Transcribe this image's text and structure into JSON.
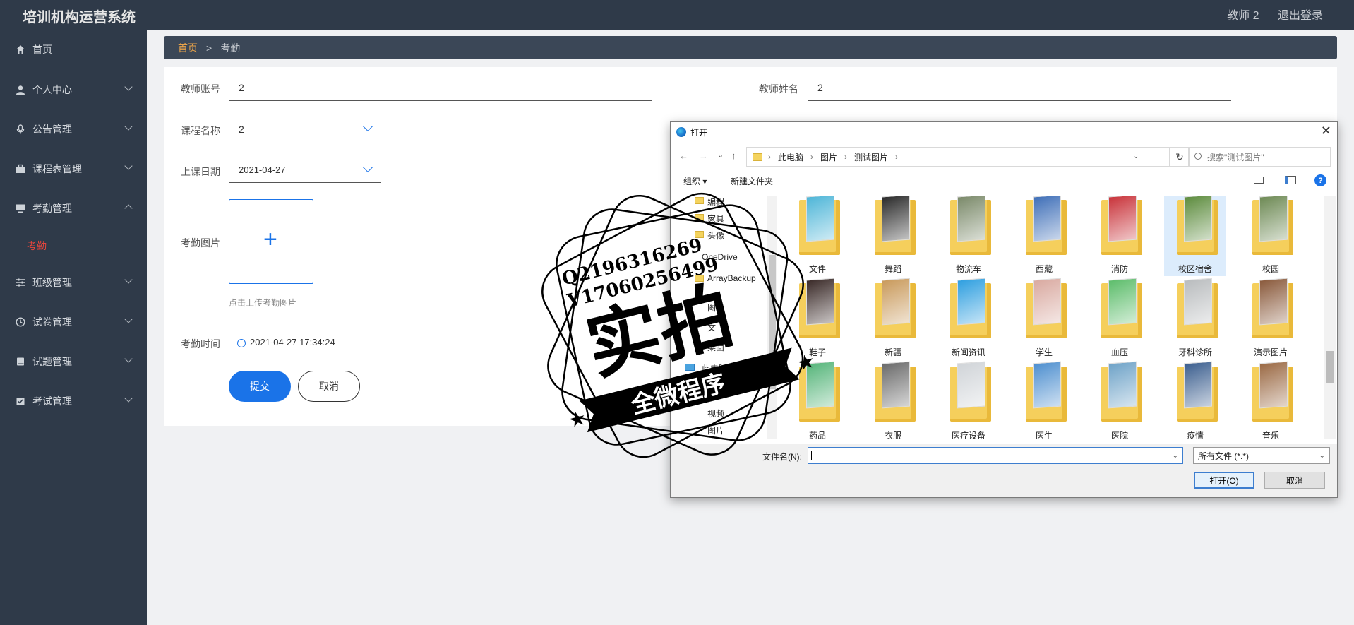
{
  "app": {
    "title": "培训机构运营系统"
  },
  "topbar": {
    "user": "教师 2",
    "logout": "退出登录"
  },
  "sidebar": {
    "items": [
      {
        "label": "首页",
        "icon": "home-icon"
      },
      {
        "label": "个人中心",
        "icon": "user-icon"
      },
      {
        "label": "公告管理",
        "icon": "microphone-icon"
      },
      {
        "label": "课程表管理",
        "icon": "briefcase-icon"
      },
      {
        "label": "考勤管理",
        "icon": "monitor-icon"
      },
      {
        "label": "班级管理",
        "icon": "sliders-icon"
      },
      {
        "label": "试卷管理",
        "icon": "clock-icon"
      },
      {
        "label": "试题管理",
        "icon": "book-icon"
      },
      {
        "label": "考试管理",
        "icon": "checklist-icon"
      }
    ],
    "sub_active": "考勤"
  },
  "breadcrumb": {
    "home": "首页",
    "separator": ">",
    "current": "考勤"
  },
  "form": {
    "teacher_account_label": "教师账号",
    "teacher_account_value": "2",
    "teacher_name_label": "教师姓名",
    "teacher_name_value": "2",
    "course_label": "课程名称",
    "course_value": "2",
    "date_label": "上课日期",
    "date_value": "2021-04-27",
    "photo_label": "考勤图片",
    "photo_hint": "点击上传考勤图片",
    "upload_plus": "+",
    "time_label": "考勤时间",
    "time_value": "2021-04-27 17:34:24",
    "submit": "提交",
    "cancel": "取消"
  },
  "dialog": {
    "title": "打开",
    "close": "✕",
    "nav": {
      "back": "←",
      "forward": "→",
      "dropdown": "⌄",
      "up": "↑"
    },
    "path": [
      "此电脑",
      "图片",
      "测试图片"
    ],
    "path_sep": "›",
    "refresh": "↻",
    "search_placeholder": "搜索\"测试图片\"",
    "toolbar": {
      "organize": "组织 ▾",
      "new_folder": "新建文件夹",
      "help": "?"
    },
    "nav_pane": [
      {
        "label": "编程",
        "type": "folder"
      },
      {
        "label": "家具",
        "type": "folder"
      },
      {
        "label": "头像",
        "type": "folder"
      },
      {
        "label": "OneDrive",
        "type": "cloud"
      },
      {
        "label": "ArrayBackup",
        "type": "folder"
      },
      {
        "label": "图",
        "type": "folder"
      },
      {
        "label": "文",
        "type": "folder"
      },
      {
        "label": "桌面",
        "type": "folder"
      },
      {
        "label": "此电脑",
        "type": "pc"
      },
      {
        "label": "视频",
        "type": "folder"
      },
      {
        "label": "图片",
        "type": "folder"
      }
    ],
    "files": [
      {
        "name": "文件",
        "color": "#4fb6d8"
      },
      {
        "name": "舞蹈",
        "color": "#2b2b2b"
      },
      {
        "name": "物流车",
        "color": "#7b8a6a"
      },
      {
        "name": "西藏",
        "color": "#3f6fb8"
      },
      {
        "name": "消防",
        "color": "#c9343b"
      },
      {
        "name": "校区宿舍",
        "color": "#5d8c3e"
      },
      {
        "name": "校园",
        "color": "#6e8a55"
      },
      {
        "name": "鞋子",
        "color": "#3a2a28"
      },
      {
        "name": "新疆",
        "color": "#c99a5c"
      },
      {
        "name": "新闻资讯",
        "color": "#2f9fe0"
      },
      {
        "name": "学生",
        "color": "#d9a9a0"
      },
      {
        "name": "血压",
        "color": "#5dbd6b"
      },
      {
        "name": "牙科诊所",
        "color": "#b9bcbe"
      },
      {
        "name": "演示图片",
        "color": "#8a5a3c"
      },
      {
        "name": "药品",
        "color": "#56b57a"
      },
      {
        "name": "衣服",
        "color": "#6b6b6b"
      },
      {
        "name": "医疗设备",
        "color": "#d0d4d8"
      },
      {
        "name": "医生",
        "color": "#4e8fcf"
      },
      {
        "name": "医院",
        "color": "#6fa3c8"
      },
      {
        "name": "疫情",
        "color": "#3c5f8f"
      },
      {
        "name": "音乐",
        "color": "#9b6a45"
      }
    ],
    "filename_label": "文件名(N):",
    "filename_value": "",
    "filetype": "所有文件 (*.*)",
    "open": "打开(O)",
    "cancel": "取消"
  },
  "watermark": {
    "line1": "Q2196316269",
    "line2": "V17060256499",
    "main": "实拍",
    "ribbon": "全微程序"
  },
  "colors": {
    "accent": "#1a73e8",
    "sidebar_bg": "#2f3a49",
    "active_red": "#e8453c",
    "breadcrumb_home": "#e8a34a"
  }
}
